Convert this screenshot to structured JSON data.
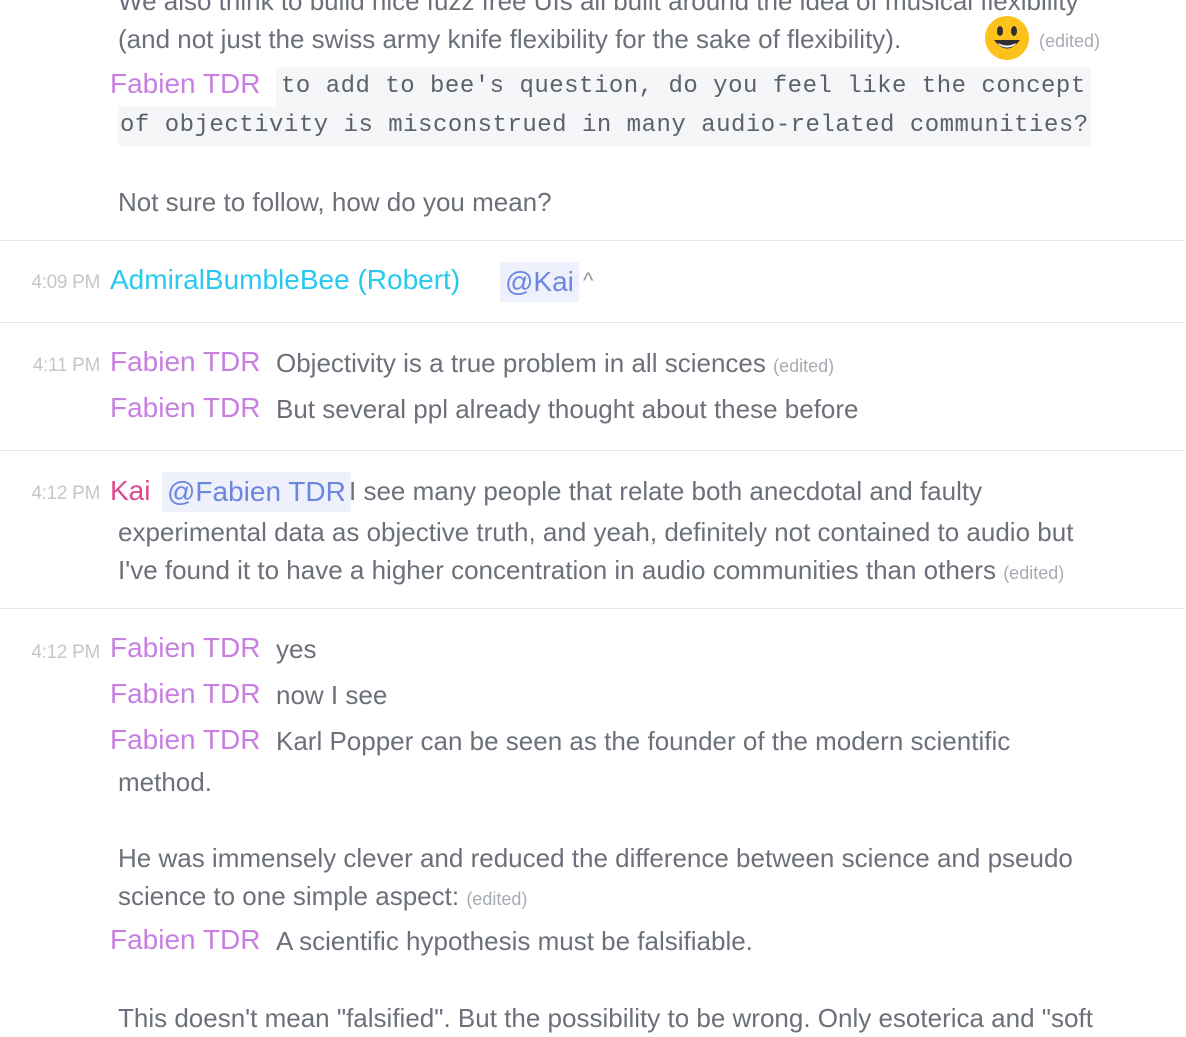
{
  "messages": {
    "m0": {
      "line1": "We also think to build nice fuzz free UIs all built around the idea of musical flexibility",
      "line2": "(and not just the swiss army knife flexibility for the sake of flexibility).",
      "emoji": "smiley-face",
      "edited": "(edited)"
    },
    "m1": {
      "author": "Fabien TDR",
      "code_line1": "to add to bee's question, do you feel like the concept",
      "code_line2": "of objectivity is misconstrued in many audio-related communities?",
      "reply": "Not sure to follow, how do you mean?"
    },
    "m2": {
      "time": "4:09 PM",
      "author": "AdmiralBumbleBee (Robert)",
      "mention": "@Kai",
      "caret": "^"
    },
    "m3": {
      "time": "4:11 PM",
      "author": "Fabien TDR",
      "text1": "Objectivity is a true problem in all sciences",
      "edited": "(edited)",
      "author2": "Fabien TDR",
      "text2": "But several ppl already thought about these before"
    },
    "m4": {
      "time": "4:12 PM",
      "author": "Kai",
      "mention": "@Fabien TDR",
      "line1": "I see many people that relate both anecdotal and faulty",
      "line2": "experimental data as objective truth, and yeah, definitely not contained to audio but",
      "line3": "I've found it to have a higher concentration in audio communities than others",
      "edited": "(edited)"
    },
    "m5": {
      "time": "4:12 PM",
      "author_a": "Fabien TDR",
      "text_a": "yes",
      "author_b": "Fabien TDR",
      "text_b": "now I see",
      "author_c": "Fabien TDR",
      "text_c1": "Karl Popper can be seen as the founder of the modern scientific",
      "text_c2": "method.",
      "text_c3": "He was immensely clever and reduced the difference between science and pseudo",
      "text_c4": "science to one simple aspect:",
      "edited_c": "(edited)",
      "author_d": "Fabien TDR",
      "text_d": "A scientific hypothesis must be falsifiable.",
      "text_e": "This doesn't mean \"falsified\". But the possibility to be wrong. Only esoterica and \"soft"
    }
  },
  "colors": {
    "fabien": "#c77fe0",
    "bee": "#29c9ef",
    "kai": "#e0478f",
    "mention": "#6c86e0",
    "text": "#6b707a"
  }
}
